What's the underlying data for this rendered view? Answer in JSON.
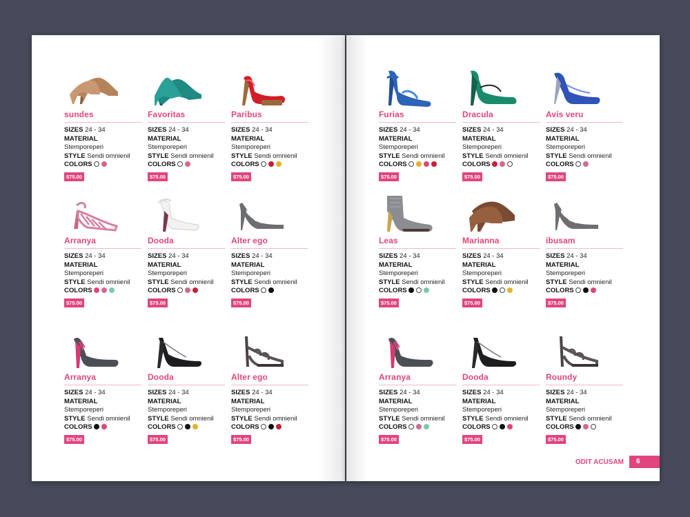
{
  "spec_labels": {
    "sizes": "SIZES",
    "material": "MATERIAL",
    "style": "STYLE",
    "colors": "COLORS"
  },
  "footer": {
    "label": "ODIT ACUSAM",
    "page": "6"
  },
  "left_page": [
    {
      "name": "sundes",
      "sizes": "24 - 34",
      "material": "Stemporeperi",
      "style": "Sendi omnienil",
      "price": "$75.00",
      "colors": [
        "outline",
        "#d16a93"
      ],
      "shoe": "nude-pump"
    },
    {
      "name": "Favoritas",
      "sizes": "24 - 34",
      "material": "Stemporeperi",
      "style": "Sendi omnienil",
      "price": "$75.00",
      "colors": [
        "outline",
        "#d16a93"
      ],
      "shoe": "teal-pump"
    },
    {
      "name": "Paribus",
      "sizes": "24 - 34",
      "material": "Stemporeperi",
      "style": "Sendi omnienil",
      "price": "$75.00",
      "colors": [
        "outline",
        "#c42238",
        "#e4b22c"
      ],
      "shoe": "red-platform"
    },
    {
      "name": "Arranya",
      "sizes": "24 - 34",
      "material": "Stemporeperi",
      "style": "Sendi omnienil",
      "price": "$75.00",
      "colors": [
        "#e0457e",
        "#d16a93",
        "#7cc9a8"
      ],
      "shoe": "pink-strappy"
    },
    {
      "name": "Dooda",
      "sizes": "24 - 34",
      "material": "Stemporeperi",
      "style": "Sendi omnienil",
      "price": "$75.00",
      "colors": [
        "outline",
        "#d16a93",
        "#c42238"
      ],
      "shoe": "white-sandal"
    },
    {
      "name": "Alter ego",
      "sizes": "24 - 34",
      "material": "Stemporeperi",
      "style": "Sendi omnienil",
      "price": "$75.00",
      "colors": [
        "outline",
        "#111111"
      ],
      "shoe": "grey-cutout"
    },
    {
      "name": "Arranya",
      "sizes": "24 - 34",
      "material": "Stemporeperi",
      "style": "Sendi omnienil",
      "price": "$75.00",
      "colors": [
        "#111111",
        "#e0457e"
      ],
      "shoe": "grey-pink-pump"
    },
    {
      "name": "Dooda",
      "sizes": "24 - 34",
      "material": "Stemporeperi",
      "style": "Sendi omnienil",
      "price": "$75.00",
      "colors": [
        "outline",
        "#111111",
        "#e4b22c"
      ],
      "shoe": "black-slingback"
    },
    {
      "name": "Alter ego",
      "sizes": "24 - 34",
      "material": "Stemporeperi",
      "style": "Sendi omnienil",
      "price": "$75.00",
      "colors": [
        "outline",
        "#111111",
        "#c42238"
      ],
      "shoe": "strappy-sandal"
    }
  ],
  "right_page": [
    {
      "name": "Furias",
      "sizes": "24 - 34",
      "material": "Stemporeperi",
      "style": "Sendi omnienil",
      "price": "$75.00",
      "colors": [
        "outline",
        "#e4b22c",
        "#e0457e",
        "#c42238"
      ],
      "shoe": "blue-sandal"
    },
    {
      "name": "Dracula",
      "sizes": "24 - 34",
      "material": "Stemporeperi",
      "style": "Sendi omnienil",
      "price": "$75.00",
      "colors": [
        "#c42238",
        "#d16a93",
        "outline"
      ],
      "shoe": "green-maryjane"
    },
    {
      "name": "Avis veru",
      "sizes": "24 - 34",
      "material": "Stemporeperi",
      "style": "Sendi omnienil",
      "price": "$75.00",
      "colors": [
        "outline",
        "#d16a93"
      ],
      "shoe": "blue-pump"
    },
    {
      "name": "Leas",
      "sizes": "24 - 34",
      "material": "Stemporeperi",
      "style": "Sendi omnienil",
      "price": "$75.00",
      "colors": [
        "#111111",
        "outline",
        "#7cc9a8"
      ],
      "shoe": "grey-bootie"
    },
    {
      "name": "Marianna",
      "sizes": "24 - 34",
      "material": "Stemporeperi",
      "style": "Sendi omnienil",
      "price": "$75.00",
      "colors": [
        "#111111",
        "outline",
        "#e4b22c"
      ],
      "shoe": "brown-platform"
    },
    {
      "name": "ibusam",
      "sizes": "24 - 34",
      "material": "Stemporeperi",
      "style": "Sendi omnienil",
      "price": "$75.00",
      "colors": [
        "outline",
        "#111111",
        "#e0457e"
      ],
      "shoe": "grey-cutout"
    },
    {
      "name": "Arranya",
      "sizes": "24 - 34",
      "material": "Stemporeperi",
      "style": "Sendi omnienil",
      "price": "$75.00",
      "colors": [
        "outline",
        "#d16a93",
        "#7cc9a8"
      ],
      "shoe": "grey-pink-pump"
    },
    {
      "name": "Dooda",
      "sizes": "24 - 34",
      "material": "Stemporeperi",
      "style": "Sendi omnienil",
      "price": "$75.00",
      "colors": [
        "outline",
        "#111111",
        "#e0457e"
      ],
      "shoe": "black-slingback"
    },
    {
      "name": "Roundy",
      "sizes": "24 - 34",
      "material": "Stemporeperi",
      "style": "Sendi omnienil",
      "price": "$75.00",
      "colors": [
        "#111111",
        "#d16a93",
        "outline"
      ],
      "shoe": "strappy-sandal"
    }
  ]
}
